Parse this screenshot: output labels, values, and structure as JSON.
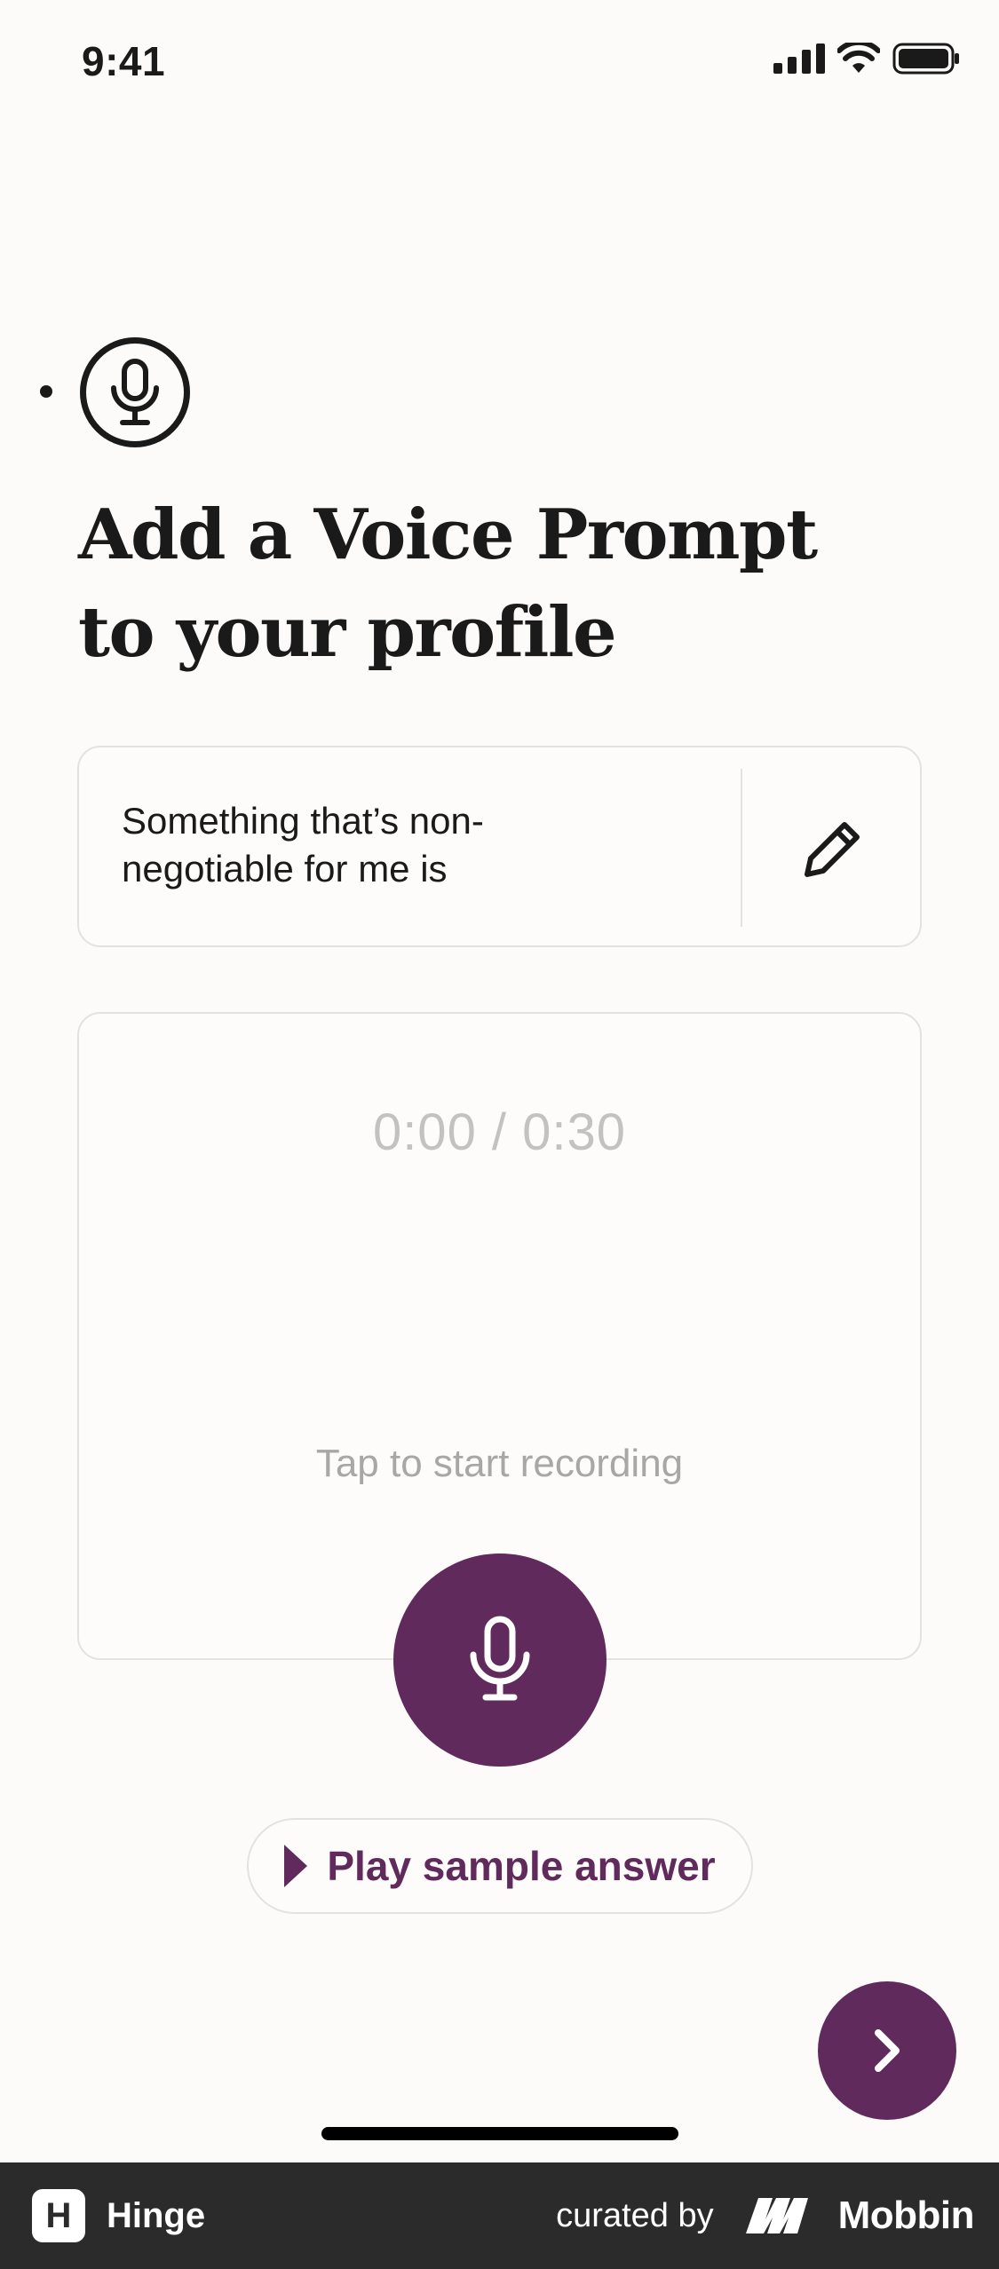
{
  "status_bar": {
    "time": "9:41"
  },
  "header": {
    "title": "Add a Voice Prompt to your profile"
  },
  "prompt_card": {
    "text": "Something that’s non-negotiable for me is"
  },
  "recording": {
    "timer": "0:00 / 0:30",
    "hint": "Tap to start recording"
  },
  "sample_button": {
    "label": "Play sample answer"
  },
  "footer": {
    "app_name": "Hinge",
    "logo_letter": "H",
    "curated_label": "curated by",
    "brand": "Mobbin"
  },
  "colors": {
    "accent": "#602a5c",
    "background": "#fcfbfa",
    "footer": "#2b2b2b"
  }
}
